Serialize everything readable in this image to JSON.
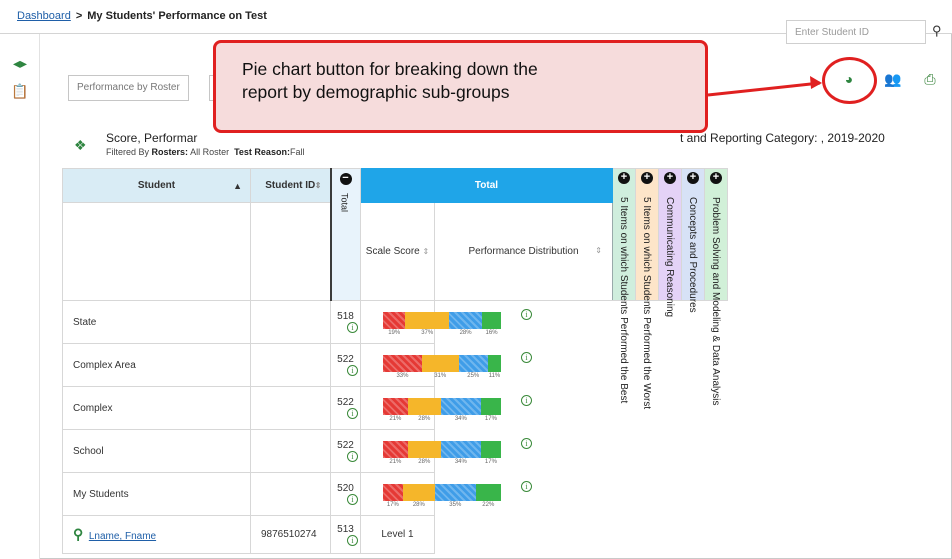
{
  "breadcrumb": {
    "link": "Dashboard",
    "separator": ">",
    "current": "My Students' Performance on Test"
  },
  "search": {
    "placeholder": "Enter Student ID",
    "icon": "search-icon"
  },
  "tabs": [
    {
      "label": "Performance by Roster"
    }
  ],
  "callout": {
    "line1": "Pie chart button for breaking down the",
    "line2": "report by demographic sub-groups"
  },
  "report": {
    "title_start": "Score, Performar",
    "title_end": "t and Reporting Category: , 2019-2020",
    "filter_label": "Filtered By",
    "filter_rosters_label": "Rosters:",
    "filter_rosters_value": "All Roster",
    "filter_reason_label": "Test Reason:",
    "filter_reason_value": "Fall"
  },
  "table": {
    "headers": {
      "student": "Student",
      "student_id": "Student ID",
      "total_vertical": "Total",
      "total_group": "Total",
      "scale_score": "Scale Score",
      "perf_dist": "Performance Distribution"
    },
    "category_columns": [
      "5 Items on which Students Performed the Best",
      "5 Items on which Students Performed the Worst",
      "Communicating Reasoning",
      "Concepts and Procedures",
      "Problem Solving and Modeling & Data Analysis"
    ],
    "rows": [
      {
        "name": "State",
        "id": "",
        "score": "518",
        "dist": [
          "19%",
          "37%",
          "28%",
          "16%"
        ],
        "w": [
          19,
          37,
          28,
          16
        ]
      },
      {
        "name": "Complex Area",
        "id": "",
        "score": "522",
        "dist": [
          "33%",
          "31%",
          "25%",
          "11%"
        ],
        "w": [
          33,
          31,
          25,
          11
        ]
      },
      {
        "name": "Complex",
        "id": "",
        "score": "522",
        "dist": [
          "21%",
          "28%",
          "34%",
          "17%"
        ],
        "w": [
          21,
          28,
          34,
          17
        ]
      },
      {
        "name": "School",
        "id": "",
        "score": "522",
        "dist": [
          "21%",
          "28%",
          "34%",
          "17%"
        ],
        "w": [
          21,
          28,
          34,
          17
        ]
      },
      {
        "name": "My Students",
        "id": "",
        "score": "520",
        "dist": [
          "17%",
          "28%",
          "35%",
          "22%"
        ],
        "w": [
          17,
          28,
          35,
          22
        ]
      }
    ],
    "student_row": {
      "name": "Lname, Fname",
      "id": "9876510274",
      "score": "513",
      "level": "Level 1"
    }
  },
  "colors": {
    "level1": "#e53935",
    "level2": "#f5b62a",
    "level3": "#3f9de8",
    "level4": "#39b54a",
    "accent": "#2e8540",
    "callout_border": "#e02020",
    "col_best": "#cfeedd",
    "col_worst": "#fde5c9",
    "col_comm": "#e4d2f7",
    "col_concepts": "#d7e2f6",
    "col_problem": "#d1f0d8"
  }
}
